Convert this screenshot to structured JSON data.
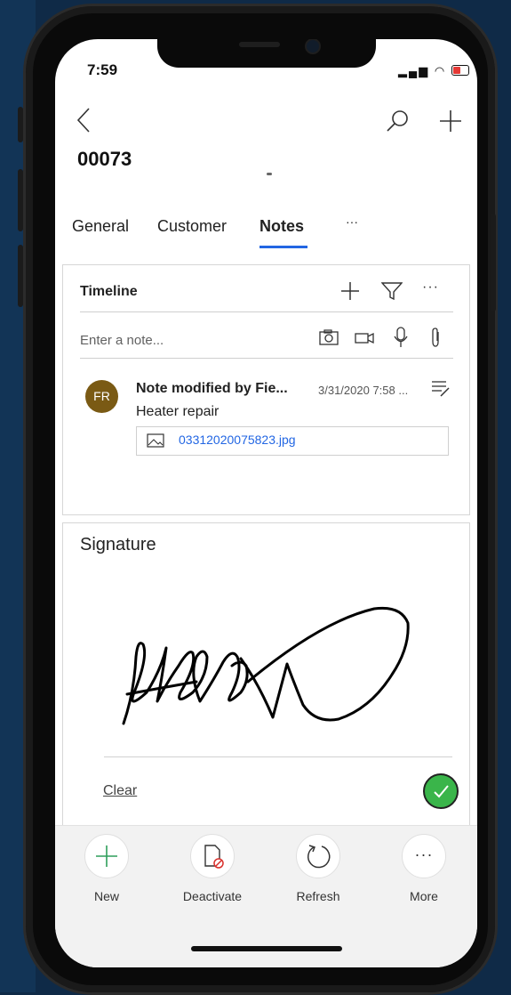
{
  "status_bar": {
    "time": "7:59"
  },
  "header": {
    "title": "00073",
    "back_icon": "chevron-left-icon",
    "search_icon": "search-icon",
    "add_icon": "plus-icon"
  },
  "tabs": [
    {
      "label": "General",
      "active": false
    },
    {
      "label": "Customer",
      "active": false
    },
    {
      "label": "Notes",
      "active": true
    },
    {
      "label": "···",
      "active": false
    }
  ],
  "timeline": {
    "title": "Timeline",
    "note_placeholder": "Enter a note...",
    "notes": [
      {
        "avatar": "FR",
        "title": "Note modified by Fie...",
        "date": "3/31/2020 7:58 ...",
        "body": "Heater repair",
        "attachment": "03312020075823.jpg"
      }
    ]
  },
  "signature": {
    "label": "Signature",
    "clear": "Clear"
  },
  "command_bar": {
    "new": "New",
    "deactivate": "Deactivate",
    "refresh": "Refresh",
    "more": "More"
  },
  "colors": {
    "accent": "#2266e3",
    "avatar": "#7a5a14",
    "confirm": "#3ab54a",
    "new_plus": "#2e9e5a",
    "deactivate_red": "#d9302c"
  }
}
